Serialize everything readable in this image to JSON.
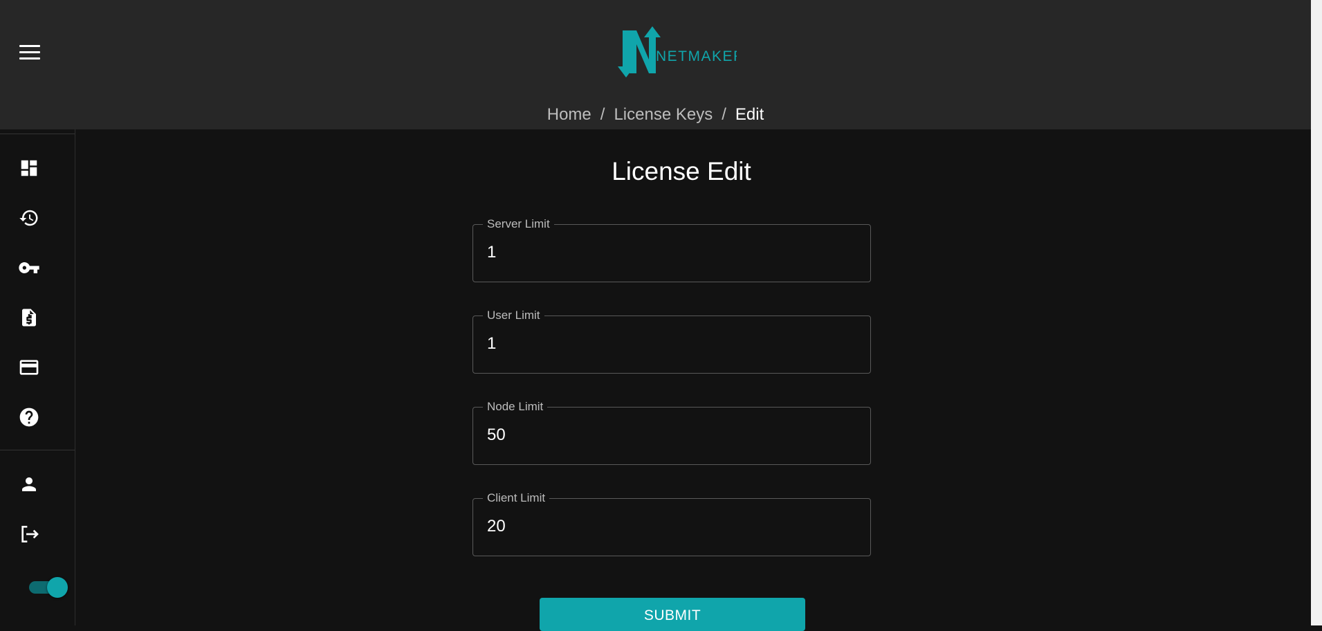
{
  "header": {
    "logo_text": "NETMAKER",
    "breadcrumb": [
      {
        "label": "Home"
      },
      {
        "label": "License Keys"
      },
      {
        "label": "Edit"
      }
    ],
    "separator": "/"
  },
  "sidebar": {
    "items": [
      {
        "icon": "dashboard-icon"
      },
      {
        "icon": "history-icon"
      },
      {
        "icon": "key-icon"
      },
      {
        "icon": "invoice-icon"
      },
      {
        "icon": "credit-card-icon"
      },
      {
        "icon": "help-icon"
      },
      {
        "icon": "account-icon"
      },
      {
        "icon": "logout-icon"
      }
    ],
    "dark_mode_toggle": {
      "on": true
    }
  },
  "form": {
    "title": "License Edit",
    "fields": [
      {
        "label": "Server Limit",
        "value": "1"
      },
      {
        "label": "User Limit",
        "value": "1"
      },
      {
        "label": "Node Limit",
        "value": "50"
      },
      {
        "label": "Client Limit",
        "value": "20"
      }
    ],
    "submit_label": "SUBMIT"
  },
  "colors": {
    "accent": "#10a5ab",
    "header_bg": "#272727",
    "page_bg": "#121212"
  }
}
